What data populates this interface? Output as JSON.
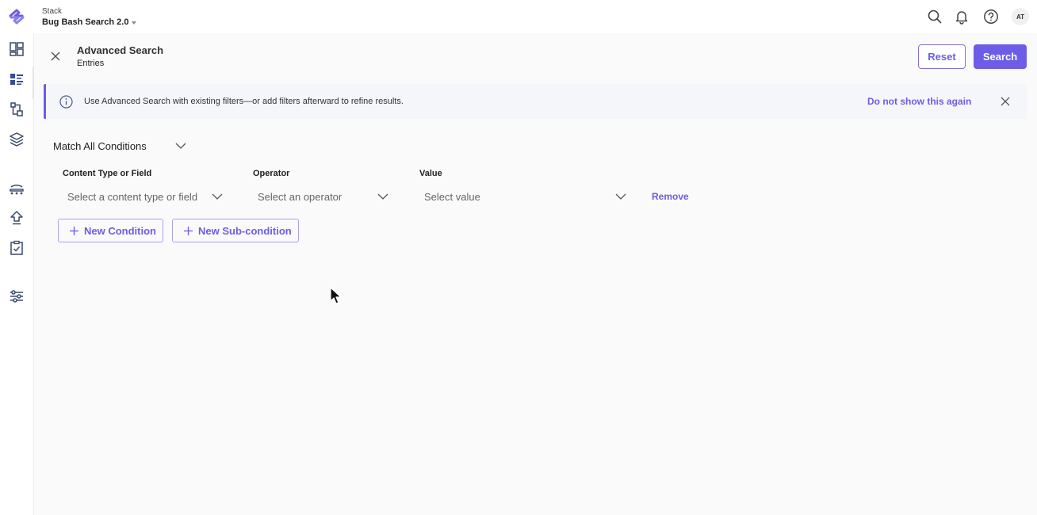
{
  "header": {
    "stack_label": "Stack",
    "stack_name": "Bug Bash Search 2.0",
    "avatar_initials": "AT",
    "icons": [
      "search-icon",
      "bell-icon",
      "help-icon"
    ]
  },
  "sidebar": {
    "icons": [
      "dashboard-icon",
      "entries-icon",
      "content-models-icon",
      "assets-icon",
      "releases-icon",
      "publish-queue-icon",
      "tasks-icon",
      "settings-icon"
    ]
  },
  "page": {
    "title": "Advanced Search",
    "subtitle": "Entries",
    "reset_label": "Reset",
    "search_label": "Search"
  },
  "banner": {
    "text": "Use Advanced Search with existing filters—or add filters afterward to refine results.",
    "dismiss_label": "Do not show this again"
  },
  "query": {
    "match_mode": "Match All Conditions",
    "columns": {
      "field": "Content Type or Field",
      "operator": "Operator",
      "value": "Value"
    },
    "condition": {
      "field_placeholder": "Select a content type or field",
      "operator_placeholder": "Select an operator",
      "value_placeholder": "Select value",
      "remove_label": "Remove"
    },
    "new_condition_label": "New Condition",
    "new_subcondition_label": "New Sub-condition"
  },
  "colors": {
    "accent": "#6c5ce7",
    "page_background": "#fafafa"
  }
}
